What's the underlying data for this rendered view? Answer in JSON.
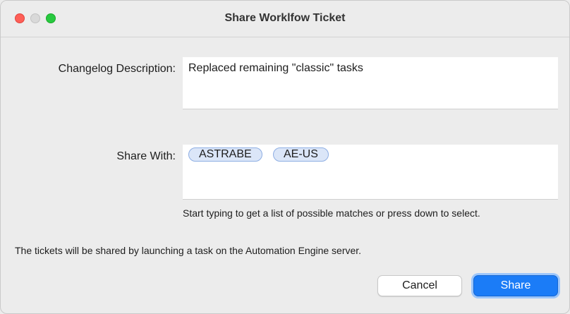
{
  "window": {
    "title": "Share Worklfow Ticket"
  },
  "form": {
    "changelog_label": "Changelog Description:",
    "changelog_value": "Replaced remaining \"classic\" tasks",
    "share_label": "Share With:",
    "share_chips": [
      "ASTRABE",
      "AE-US"
    ],
    "share_hint": "Start typing to get a list of possible matches or press down to select.",
    "info_text": "The tickets will be shared by launching a task on the Automation Engine server."
  },
  "buttons": {
    "cancel_label": "Cancel",
    "share_label": "Share"
  },
  "colors": {
    "accent": "#1b7cf7",
    "chip_fill": "#dbe6f8",
    "chip_border": "#8eaee3",
    "close_traffic": "#fe5f57",
    "zoom_traffic": "#28c940"
  }
}
